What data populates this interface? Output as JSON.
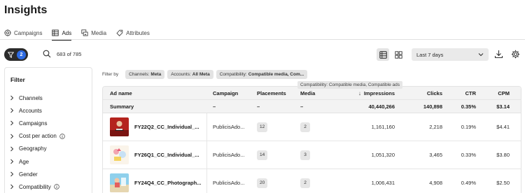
{
  "page": {
    "title": "Insights"
  },
  "tabs": [
    {
      "label": "Campaigns",
      "icon": "target-icon",
      "active": false
    },
    {
      "label": "Ads",
      "icon": "table-icon",
      "active": true
    },
    {
      "label": "Media",
      "icon": "media-icon",
      "active": false
    },
    {
      "label": "Attributes",
      "icon": "tag-icon",
      "active": false
    }
  ],
  "toolbar": {
    "filter_count": "2",
    "result_count": "683 of 785",
    "date_range": "Last 7 days"
  },
  "sidebar": {
    "title": "Filter",
    "items": [
      {
        "label": "Channels",
        "info": false
      },
      {
        "label": "Accounts",
        "info": false
      },
      {
        "label": "Campaigns",
        "info": false
      },
      {
        "label": "Cost per action",
        "info": true
      },
      {
        "label": "Geography",
        "info": false
      },
      {
        "label": "Age",
        "info": false
      },
      {
        "label": "Gender",
        "info": false
      },
      {
        "label": "Compatibility",
        "info": true
      }
    ]
  },
  "filters": {
    "label": "Filter by",
    "chips": [
      {
        "key": "Channels:",
        "value": "Meta"
      },
      {
        "key": "Accounts:",
        "value": "All Meta"
      },
      {
        "key": "Compatibility:",
        "value": "Compatible media, Com..."
      }
    ],
    "tooltip": "Compatibility: Compatible media, Compatible ads"
  },
  "table": {
    "columns": {
      "ad_name": "Ad name",
      "campaign": "Campaign",
      "placements": "Placements",
      "media": "Media",
      "impressions": "Impressions",
      "clicks": "Clicks",
      "ctr": "CTR",
      "cpm": "CPM"
    },
    "summary": {
      "label": "Summary",
      "campaign": "–",
      "placements": "–",
      "media": "–",
      "impressions": "40,440,266",
      "clicks": "140,898",
      "ctr": "0.35%",
      "cpm": "$3.14"
    },
    "rows": [
      {
        "name": "FY22Q2_CC_Individual_...",
        "campaign": "PublicisAdo...",
        "placements": "12",
        "media": "2",
        "impressions": "1,161,160",
        "clicks": "2,218",
        "ctr": "0.19%",
        "cpm": "$4.41"
      },
      {
        "name": "FY26Q1_CC_Individual_...",
        "campaign": "PublicisAdo...",
        "placements": "14",
        "media": "3",
        "impressions": "1,051,320",
        "clicks": "3,465",
        "ctr": "0.33%",
        "cpm": "$3.80"
      },
      {
        "name": "FY24Q4_CC_Photograph...",
        "campaign": "PublicisAdo...",
        "placements": "20",
        "media": "2",
        "impressions": "1,006,431",
        "clicks": "4,908",
        "ctr": "0.49%",
        "cpm": "$2.50"
      }
    ]
  },
  "colors": {
    "accent": "#2d6be3",
    "dark": "#2b2b2b",
    "header_bg": "#f3f3f3"
  }
}
